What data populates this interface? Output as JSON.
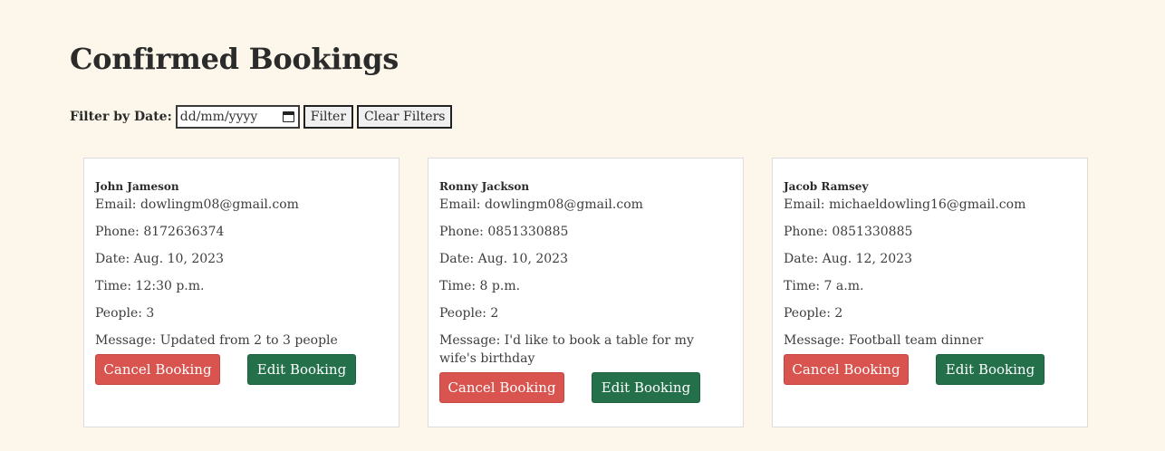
{
  "page": {
    "title": "Confirmed Bookings"
  },
  "filter": {
    "label": "Filter by Date:",
    "date_placeholder": "dd/mm/yyyy",
    "filter_button": "Filter",
    "clear_button": "Clear Filters"
  },
  "bookings": [
    {
      "name": "John Jameson",
      "email": "Email: dowlingm08@gmail.com",
      "phone": "Phone: 8172636374",
      "date": "Date: Aug. 10, 2023",
      "time": "Time: 12:30 p.m.",
      "people": "People: 3",
      "message": "Message: Updated from 2 to 3 people",
      "cancel_label": "Cancel Booking",
      "edit_label": "Edit Booking"
    },
    {
      "name": "Ronny Jackson",
      "email": "Email: dowlingm08@gmail.com",
      "phone": "Phone: 0851330885",
      "date": "Date: Aug. 10, 2023",
      "time": "Time: 8 p.m.",
      "people": "People: 2",
      "message": "Message: I'd like to book a table for my wife's birthday",
      "cancel_label": "Cancel Booking",
      "edit_label": "Edit Booking"
    },
    {
      "name": "Jacob Ramsey",
      "email": "Email: michaeldowling16@gmail.com",
      "phone": "Phone: 0851330885",
      "date": "Date: Aug. 12, 2023",
      "time": "Time: 7 a.m.",
      "people": "People: 2",
      "message": "Message: Football team dinner",
      "cancel_label": "Cancel Booking",
      "edit_label": "Edit Booking"
    }
  ],
  "colors": {
    "background": "#fcf7ea",
    "cancel": "#d9534f",
    "edit": "#23704a"
  }
}
